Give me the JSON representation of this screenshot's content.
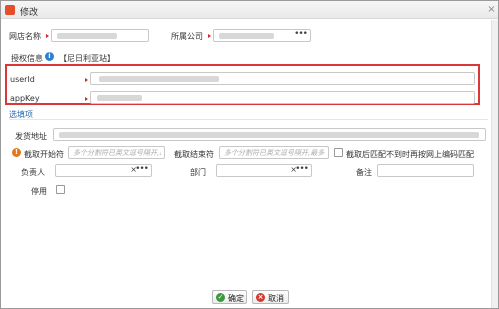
{
  "dialog": {
    "title": "修改",
    "close_icon": "×"
  },
  "fields": {
    "shop_name_label": "网店名称",
    "company_label": "所属公司",
    "auth_label": "授权信息",
    "auth_platform": "【尼日利亚站】",
    "userid_label": "userId",
    "appkey_label": "appKey",
    "optional_section": "选填项",
    "ship_address_label": "发货地址",
    "start_char_label": "截取开始符",
    "start_char_placeholder": "多个分割符已英文逗号隔开,最多",
    "end_char_label": "截取结束符",
    "end_char_placeholder": "多个分割符已英文逗号隔开,最多",
    "match_option_label": "截取后匹配不到时再按网上编码匹配",
    "owner_label": "负责人",
    "dept_label": "部门",
    "remark_label": "备注",
    "disable_label": "停用"
  },
  "buttons": {
    "ok": "确定",
    "cancel": "取消"
  },
  "icons": {
    "info": "i",
    "warn": "!",
    "ellipsis": "•••",
    "clear": "×",
    "ok_icon": "✓",
    "cancel_icon": "×"
  },
  "colors": {
    "highlight": "#d9373a",
    "required": "#d9261c",
    "section": "#2a6bb1"
  }
}
